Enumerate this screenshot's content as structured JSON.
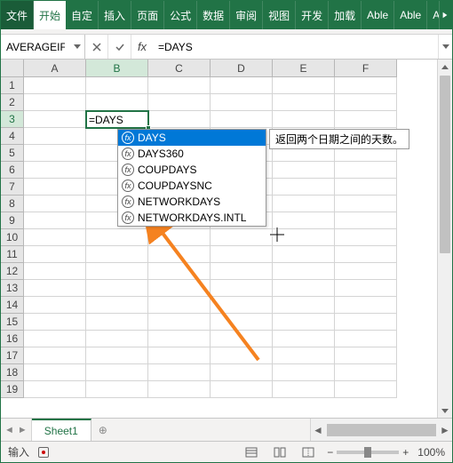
{
  "ribbon": {
    "tabs": [
      "文件",
      "开始",
      "自定",
      "插入",
      "页面",
      "公式",
      "数据",
      "审阅",
      "视图",
      "开发",
      "加载",
      "Able",
      "Able",
      "A"
    ],
    "activeIndex": 1
  },
  "formulaBar": {
    "nameBox": "AVERAGEIF",
    "fx": "fx",
    "formula": "=DAYS"
  },
  "grid": {
    "cols": [
      "A",
      "B",
      "C",
      "D",
      "E",
      "F"
    ],
    "rows": [
      1,
      2,
      3,
      4,
      5,
      6,
      7,
      8,
      9,
      10,
      11,
      12,
      13,
      14,
      15,
      16,
      17,
      18,
      19
    ],
    "activeCol": "B",
    "activeRow": 3,
    "activeCellText": "=DAYS"
  },
  "autocomplete": {
    "items": [
      "DAYS",
      "DAYS360",
      "COUPDAYS",
      "COUPDAYSNC",
      "NETWORKDAYS",
      "NETWORKDAYS.INTL"
    ],
    "selectedIndex": 0,
    "tooltip": "返回两个日期之间的天数。"
  },
  "sheets": {
    "active": "Sheet1"
  },
  "status": {
    "mode": "输入",
    "zoom": "100%"
  },
  "colors": {
    "accent": "#217346",
    "highlight": "#0078d7",
    "arrow": "#f58220"
  }
}
